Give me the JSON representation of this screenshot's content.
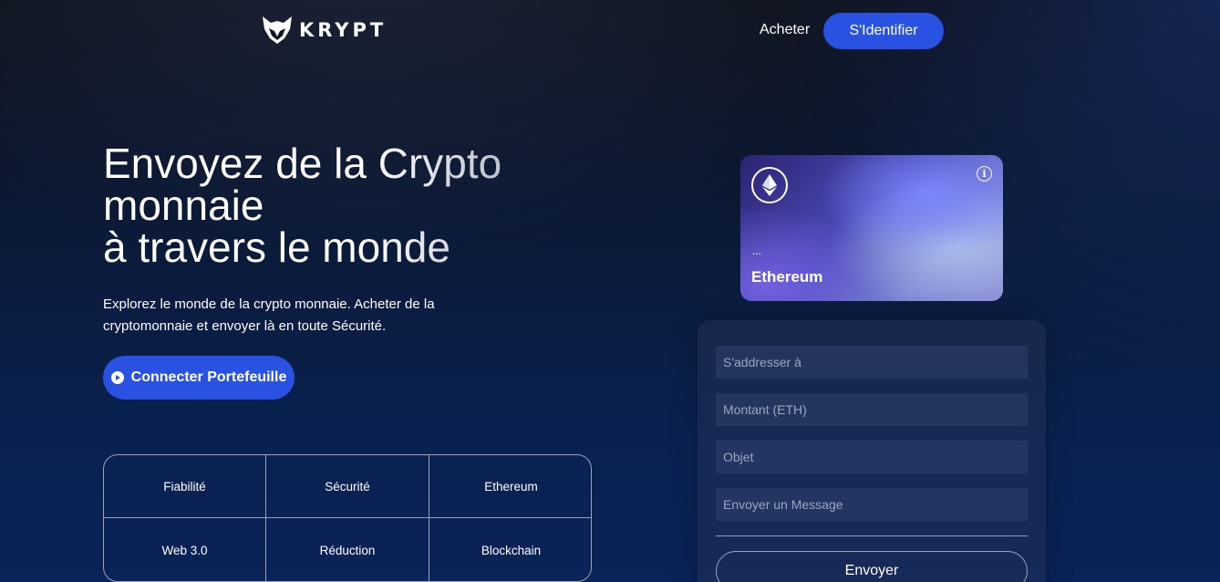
{
  "brand": {
    "name": "KRYPT",
    "logo_icon": "fox-icon"
  },
  "nav": {
    "buy_label": "Acheter",
    "login_label": "S'Identifier"
  },
  "hero": {
    "title_lines": [
      "Envoyez de la Crypto",
      "monnaie",
      "à travers le monde"
    ],
    "description": "Explorez le monde de la crypto monnaie. Acheter de la cryptomonnaie et envoyer là en toute Sécurité.",
    "connect_label": "Connecter Portefeuille"
  },
  "features": [
    "Fiabilité",
    "Sécurité",
    "Ethereum",
    "Web 3.0",
    "Réduction",
    "Blockchain"
  ],
  "card": {
    "address": "...",
    "name": "Ethereum",
    "icon": "ethereum-icon",
    "info_icon": "info-icon"
  },
  "form": {
    "address_placeholder": "S'addresser à",
    "amount_placeholder": "Montant (ETH)",
    "subject_placeholder": "Objet",
    "message_placeholder": "Envoyer un Message",
    "submit_label": "Envoyer"
  },
  "colors": {
    "accent": "#2952e3",
    "background": "#0b1a38",
    "border": "#9ba3b8"
  }
}
